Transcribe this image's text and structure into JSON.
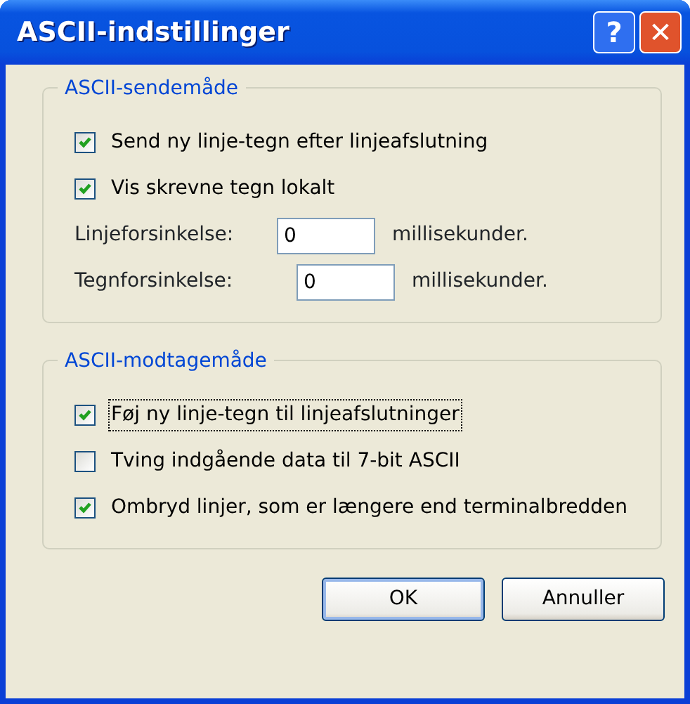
{
  "window": {
    "title": "ASCII-indstillinger",
    "title_buttons": [
      {
        "kind": "help",
        "label": "?"
      },
      {
        "kind": "close",
        "label": "✕"
      }
    ]
  },
  "groups": [
    {
      "title": "ASCII-sendemåde",
      "items": [
        {
          "kind": "checkbox",
          "label": "Send ny linje-tegn efter linjeafslutning",
          "checked": true,
          "focused": false
        },
        {
          "kind": "checkbox",
          "label": "Vis skrevne tegn lokalt",
          "checked": true,
          "focused": false
        },
        {
          "kind": "field",
          "label": "Linjeforsinkelse:",
          "value": "0",
          "unit": "millisekunder."
        },
        {
          "kind": "field",
          "label": "Tegnforsinkelse:",
          "value": "0",
          "unit": "millisekunder."
        }
      ]
    },
    {
      "title": "ASCII-modtagemåde",
      "items": [
        {
          "kind": "checkbox",
          "label": "Føj ny linje-tegn til linjeafslutninger",
          "checked": true,
          "focused": true
        },
        {
          "kind": "checkbox",
          "label": "Tving indgående data til 7-bit ASCII",
          "checked": false,
          "focused": false
        },
        {
          "kind": "checkbox",
          "label": "Ombryd linjer, som er længere end terminalbredden",
          "checked": true,
          "focused": false
        }
      ]
    }
  ],
  "buttons": [
    {
      "label": "OK",
      "default": true
    },
    {
      "label": "Annuller",
      "default": false
    }
  ]
}
